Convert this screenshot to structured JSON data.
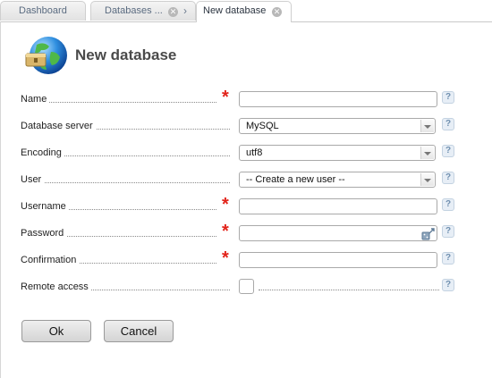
{
  "tabs": [
    {
      "label": "Dashboard",
      "closable": false,
      "active": false
    },
    {
      "label": "Databases ...",
      "closable": true,
      "active": false
    },
    {
      "label": "New database",
      "closable": true,
      "active": true
    }
  ],
  "page_title": "New database",
  "form": {
    "fields": [
      {
        "label": "Name",
        "type": "text",
        "required": true,
        "value": ""
      },
      {
        "label": "Database server",
        "type": "select",
        "required": false,
        "value": "MySQL"
      },
      {
        "label": "Encoding",
        "type": "select",
        "required": false,
        "value": "utf8"
      },
      {
        "label": "User",
        "type": "select",
        "required": false,
        "value": "-- Create a new user --"
      },
      {
        "label": "Username",
        "type": "text",
        "required": true,
        "value": ""
      },
      {
        "label": "Password",
        "type": "password",
        "required": true,
        "value": ""
      },
      {
        "label": "Confirmation",
        "type": "password",
        "required": true,
        "value": ""
      },
      {
        "label": "Remote access",
        "type": "checkbox",
        "required": false,
        "checked": false
      }
    ],
    "help_glyph": "?",
    "required_glyph": "*"
  },
  "buttons": {
    "ok": "Ok",
    "cancel": "Cancel"
  },
  "icons": {
    "tab_close": "close-icon",
    "breadcrumb": "chevron-right-icon",
    "header": "database-globe-icon",
    "password_generator": "password-generator-icon",
    "help": "help-icon"
  },
  "colors": {
    "required": "#e2231a",
    "help_bg": "#e7eef6",
    "help_fg": "#6f8faf",
    "tab_text": "#5a6b80"
  }
}
